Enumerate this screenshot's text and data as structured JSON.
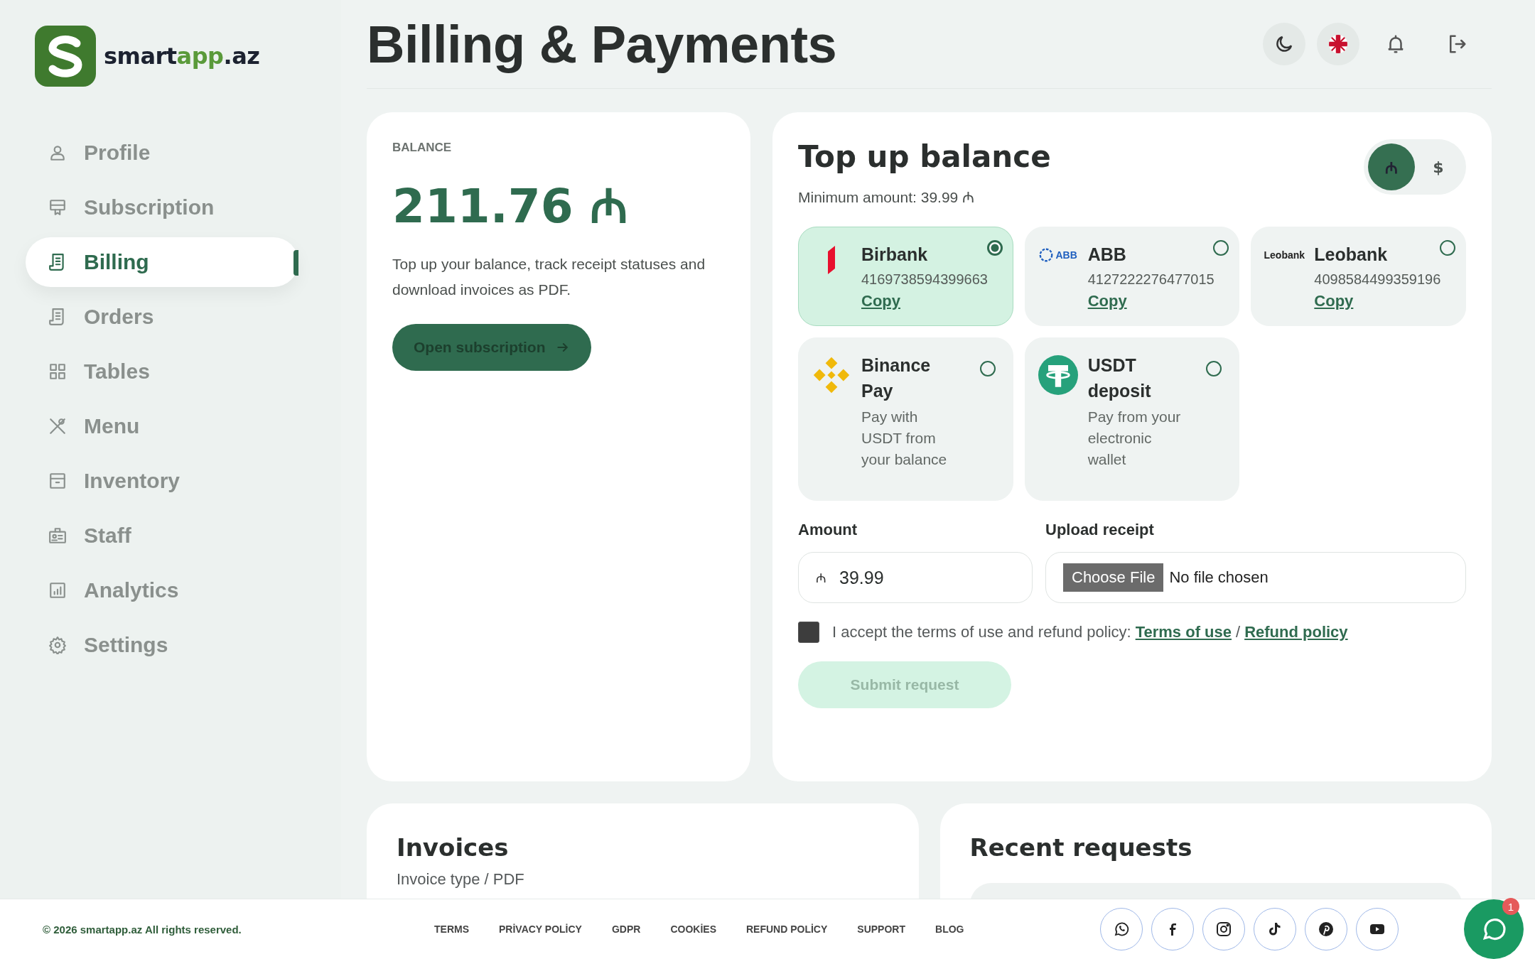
{
  "logo": {
    "part_1": "smart",
    "part_2": "app",
    "part_3": ".az"
  },
  "page_title": "Billing & Payments",
  "sidebar": {
    "items": [
      {
        "label": "Profile",
        "selected": false
      },
      {
        "label": "Subscription",
        "selected": false
      },
      {
        "label": "Billing",
        "selected": true
      },
      {
        "label": "Orders",
        "selected": false
      },
      {
        "label": "Tables",
        "selected": false
      },
      {
        "label": "Menu",
        "selected": false
      },
      {
        "label": "Inventory",
        "selected": false
      },
      {
        "label": "Staff",
        "selected": false
      },
      {
        "label": "Analytics",
        "selected": false
      },
      {
        "label": "Settings",
        "selected": false
      }
    ]
  },
  "balance": {
    "label": "BALANCE",
    "amount": "211.76 ₼",
    "description": "Top up your balance, track receipt statuses and download invoices as PDF.",
    "button": "Open subscription"
  },
  "top_up": {
    "title": "Top up balance",
    "minimum": "Minimum amount: 39.99 ₼",
    "currencies": [
      {
        "symbol": "₼",
        "selected": true
      },
      {
        "symbol": "$",
        "selected": false
      }
    ],
    "methods": [
      {
        "kind": "bank",
        "name": "Birbank",
        "number": "4169738594399663",
        "copy": "Copy",
        "selected": true
      },
      {
        "kind": "bank",
        "name": "ABB",
        "logo_text": "ABB",
        "number": "4127222276477015",
        "copy": "Copy",
        "selected": false
      },
      {
        "kind": "bank",
        "name": "Leobank",
        "logo_text": "Leobank",
        "number": "4098584499359196",
        "copy": "Copy",
        "selected": false
      },
      {
        "kind": "crypto",
        "name": "Binance Pay",
        "description": "Pay with USDT from your balance",
        "selected": false
      },
      {
        "kind": "crypto",
        "name": "USDT deposit",
        "description": "Pay from your electronic wallet",
        "selected": false
      }
    ],
    "amount": {
      "label": "Amount",
      "currency": "₼",
      "value": "39.99"
    },
    "receipt": {
      "label": "Upload receipt",
      "button": "Choose File",
      "status": "No file chosen"
    },
    "terms": {
      "checked": false,
      "text": "I accept the terms of use and refund policy:",
      "link_1": "Terms of use",
      "separator": "/",
      "link_2": "Refund policy"
    },
    "submit": {
      "label": "Submit request",
      "disabled": true
    }
  },
  "invoices": {
    "title": "Invoices",
    "subtitle": "Invoice type / PDF"
  },
  "recent_requests": {
    "title": "Recent requests"
  },
  "footer": {
    "copyright": "© 2026 smartapp.az All rights reserved.",
    "links": [
      "TERMS",
      "PRİVACY POLİCY",
      "GDPR",
      "COOKİES",
      "REFUND POLİCY",
      "SUPPORT",
      "BLOG"
    ],
    "chat_badge": "1"
  }
}
